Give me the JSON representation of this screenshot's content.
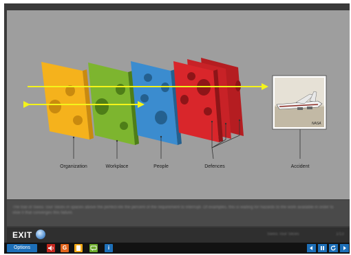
{
  "diagram": {
    "labels": {
      "organization": "Organization",
      "workplace": "Workplace",
      "people": "People",
      "defences": "Defences",
      "accident": "Accident"
    },
    "photo_credit": "NASA",
    "colors": {
      "organization": "#f5b21c",
      "workplace": "#7db52f",
      "people": "#3b8ccf",
      "defences": "#d9262b",
      "arrow": "#f4f41a",
      "slide_bg": "#9e9e9e"
    }
  },
  "caption": {
    "text": "The trail of Swiss Tour Slices in spaces above the perfect-life the percent of the requirement to interrupt. Of examples, this is waiting for hazards to the work available in order to slow it that converges this failure."
  },
  "exit_bar": {
    "exit_label": "EXIT",
    "right_text_1": "Swiss Tour Slices",
    "right_text_2": "1/13"
  },
  "toolbar": {
    "options_label": "Options",
    "icons": [
      "audio-icon",
      "glossary-icon",
      "notes-icon",
      "comment-icon",
      "info-icon"
    ],
    "nav": [
      "previous-icon",
      "pause-icon",
      "replay-icon",
      "next-icon"
    ]
  }
}
